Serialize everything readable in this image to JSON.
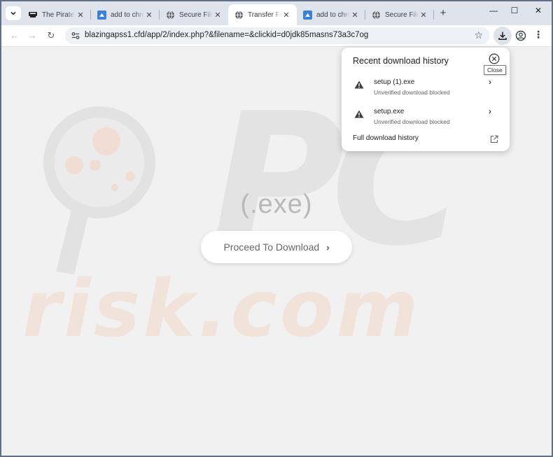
{
  "tabs": [
    {
      "title": "The Pirate Bay",
      "icon": "pirate-ship-icon",
      "active": false
    },
    {
      "title": "add to chrome",
      "icon": "cloud-app-icon",
      "active": false
    },
    {
      "title": "Secure File",
      "icon": "globe-icon",
      "active": false
    },
    {
      "title": "Transfer File",
      "icon": "globe-icon",
      "active": true
    },
    {
      "title": "add to chrome",
      "icon": "cloud-app-icon",
      "active": false
    },
    {
      "title": "Secure File",
      "icon": "globe-icon",
      "active": false
    }
  ],
  "tab_close_glyph": "✕",
  "new_tab_glyph": "+",
  "window_controls": {
    "minimize": "—",
    "maximize": "☐",
    "close": "✕"
  },
  "toolbar": {
    "back_glyph": "←",
    "forward_glyph": "→",
    "reload_glyph": "↻",
    "url": "blazingapss1.cfd/app/2/index.php?&filename=&clickid=d0jdk85masns73a3c7og",
    "bookmark_glyph": "☆",
    "menu_glyph": "⋮"
  },
  "page": {
    "exe_label": "(.exe)",
    "proceed_label": "Proceed To Download",
    "proceed_chevron": "›"
  },
  "download_bubble": {
    "title": "Recent download history",
    "close_tooltip": "Close",
    "items": [
      {
        "filename": "setup (1).exe",
        "status": "Unverified download blocked",
        "chevron": "›"
      },
      {
        "filename": "setup.exe",
        "status": "Unverified download blocked",
        "chevron": "›"
      }
    ],
    "full_history_label": "Full download history"
  },
  "colors": {
    "tabstrip_bg": "#dfe3eb",
    "page_bg": "#f1f1f1",
    "button_text": "#666666",
    "watermark_orange": "#f2e3da"
  }
}
